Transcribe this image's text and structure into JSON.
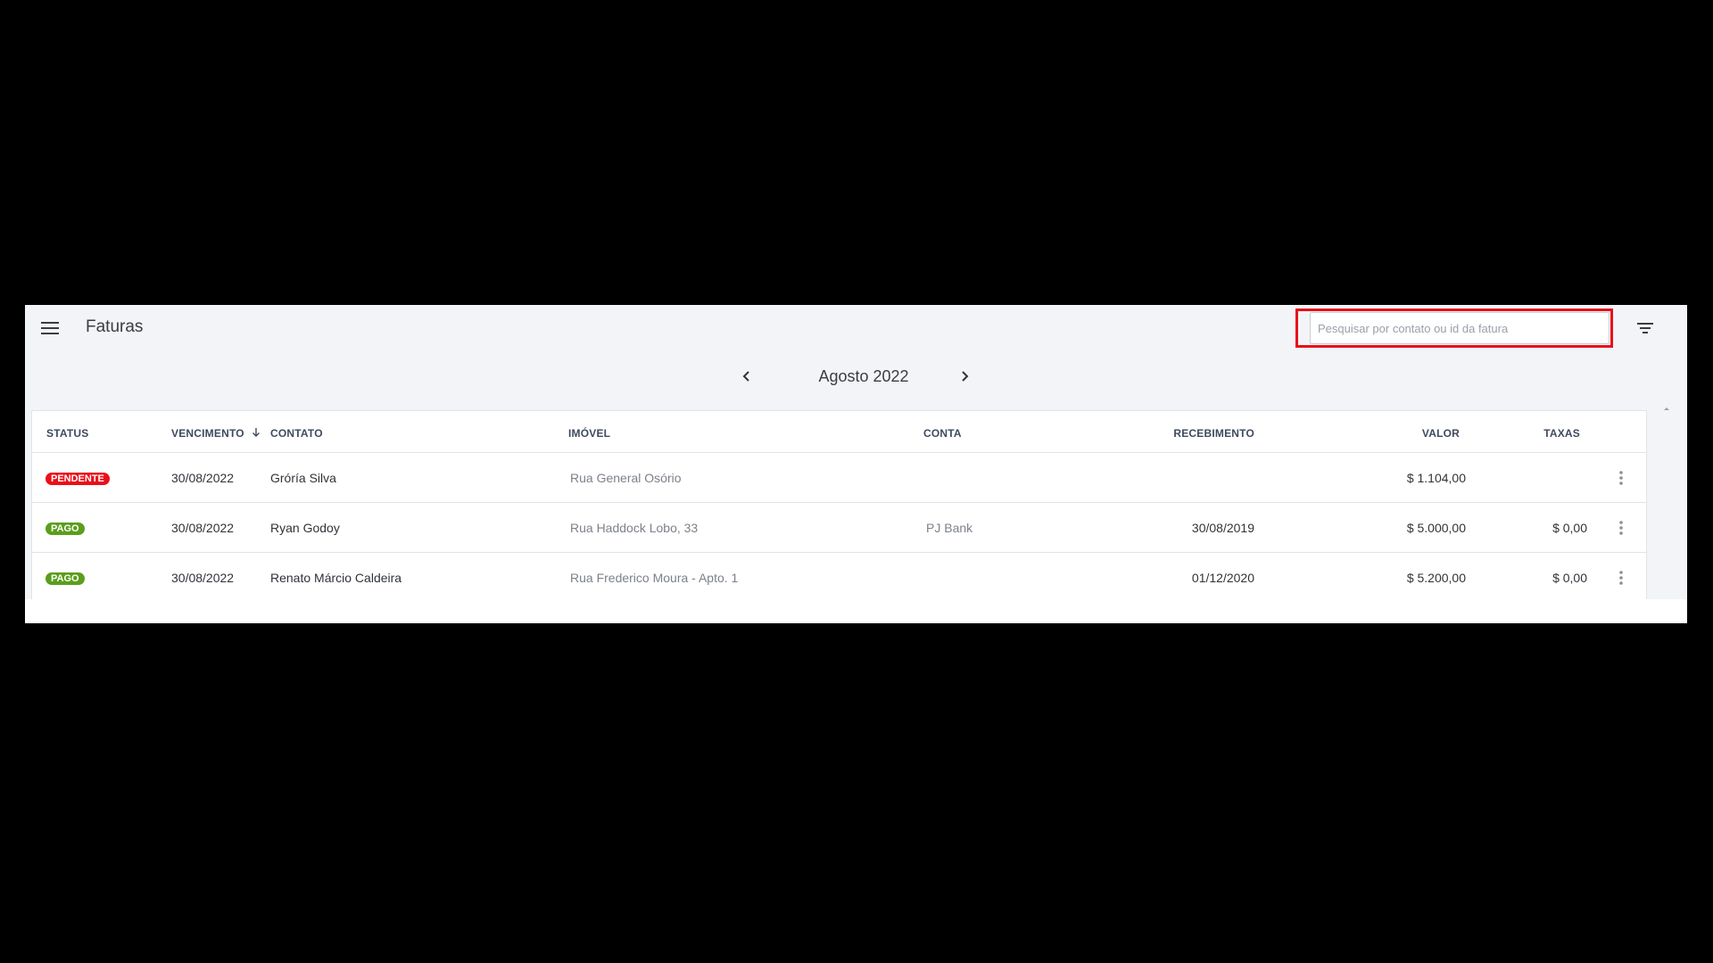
{
  "header": {
    "title": "Faturas",
    "search_placeholder": "Pesquisar por contato ou id da fatura",
    "search_value": ""
  },
  "month_nav": {
    "label": "Agosto 2022"
  },
  "table": {
    "columns": {
      "status": "STATUS",
      "vencimento": "VENCIMENTO",
      "contato": "CONTATO",
      "imovel": "IMÓVEL",
      "conta": "CONTA",
      "recebimento": "RECEBIMENTO",
      "valor": "VALOR",
      "taxas": "TAXAS"
    },
    "sort_indicator": "arrow-down-icon",
    "rows": [
      {
        "status": "PENDENTE",
        "status_color": "#e8101a",
        "vencimento": "30/08/2022",
        "contato": "Gróría Silva",
        "imovel": "Rua General Osório",
        "conta": "",
        "recebimento": "",
        "valor": "$ 1.104,00",
        "taxas": ""
      },
      {
        "status": "PAGO",
        "status_color": "#5a9e1c",
        "vencimento": "30/08/2022",
        "contato": "Ryan Godoy",
        "imovel": "Rua Haddock Lobo, 33",
        "conta": "PJ Bank",
        "recebimento": "30/08/2019",
        "valor": "$ 5.000,00",
        "taxas": "$ 0,00"
      },
      {
        "status": "PAGO",
        "status_color": "#5a9e1c",
        "vencimento": "30/08/2022",
        "contato": "Renato Márcio Caldeira",
        "imovel": "Rua Frederico Moura - Apto. 1",
        "conta": "",
        "recebimento": "01/12/2020",
        "valor": "$ 5.200,00",
        "taxas": "$ 0,00"
      }
    ]
  },
  "icons": {
    "menu": "menu-icon",
    "filter": "filter-icon",
    "prev": "chevron-left-icon",
    "next": "chevron-right-icon",
    "row_actions": "more-vertical-icon"
  },
  "colors": {
    "highlight": "#e8101a",
    "pending": "#e8101a",
    "paid": "#5a9e1c"
  }
}
